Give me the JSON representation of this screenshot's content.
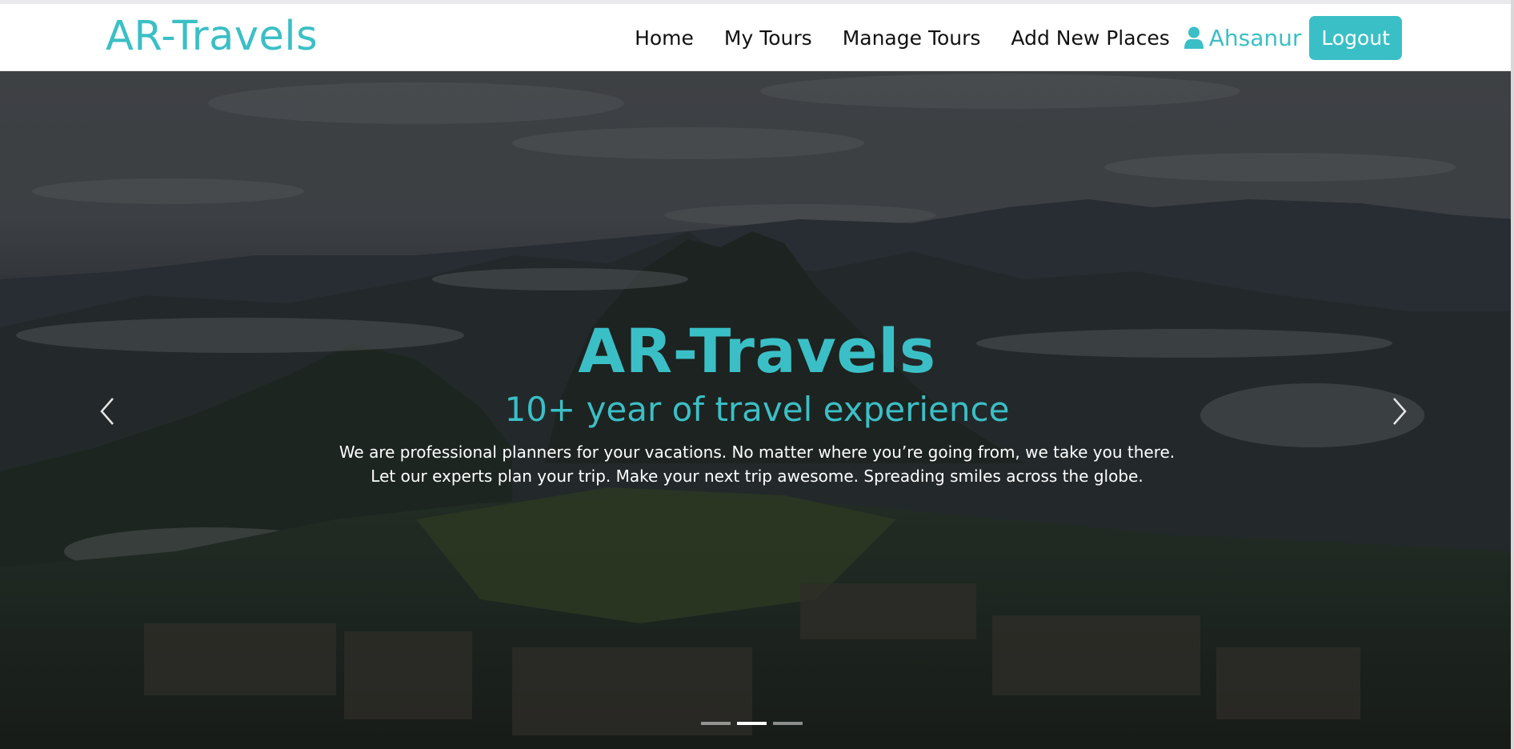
{
  "navbar": {
    "brand": "AR-Travels",
    "links": [
      {
        "label": "Home"
      },
      {
        "label": "My Tours"
      },
      {
        "label": "Manage Tours"
      },
      {
        "label": "Add New Places"
      }
    ],
    "user": {
      "icon": "user-icon",
      "name": "Ahsanur"
    },
    "logout_label": "Logout"
  },
  "hero": {
    "title": "AR-Travels",
    "subtitle": "10+ year of travel experience",
    "text": "We are professional planners for your vacations. No matter where you’re going from, we take you there. Let our experts plan your trip. Make your next trip awesome. Spreading smiles across the globe.",
    "prev_icon": "chevron-left-icon",
    "next_icon": "chevron-right-icon",
    "slides_total": 3,
    "active_slide": 2
  },
  "colors": {
    "accent": "#3bbfc6",
    "hero_text": "#ffffff",
    "nav_text": "#111111"
  }
}
